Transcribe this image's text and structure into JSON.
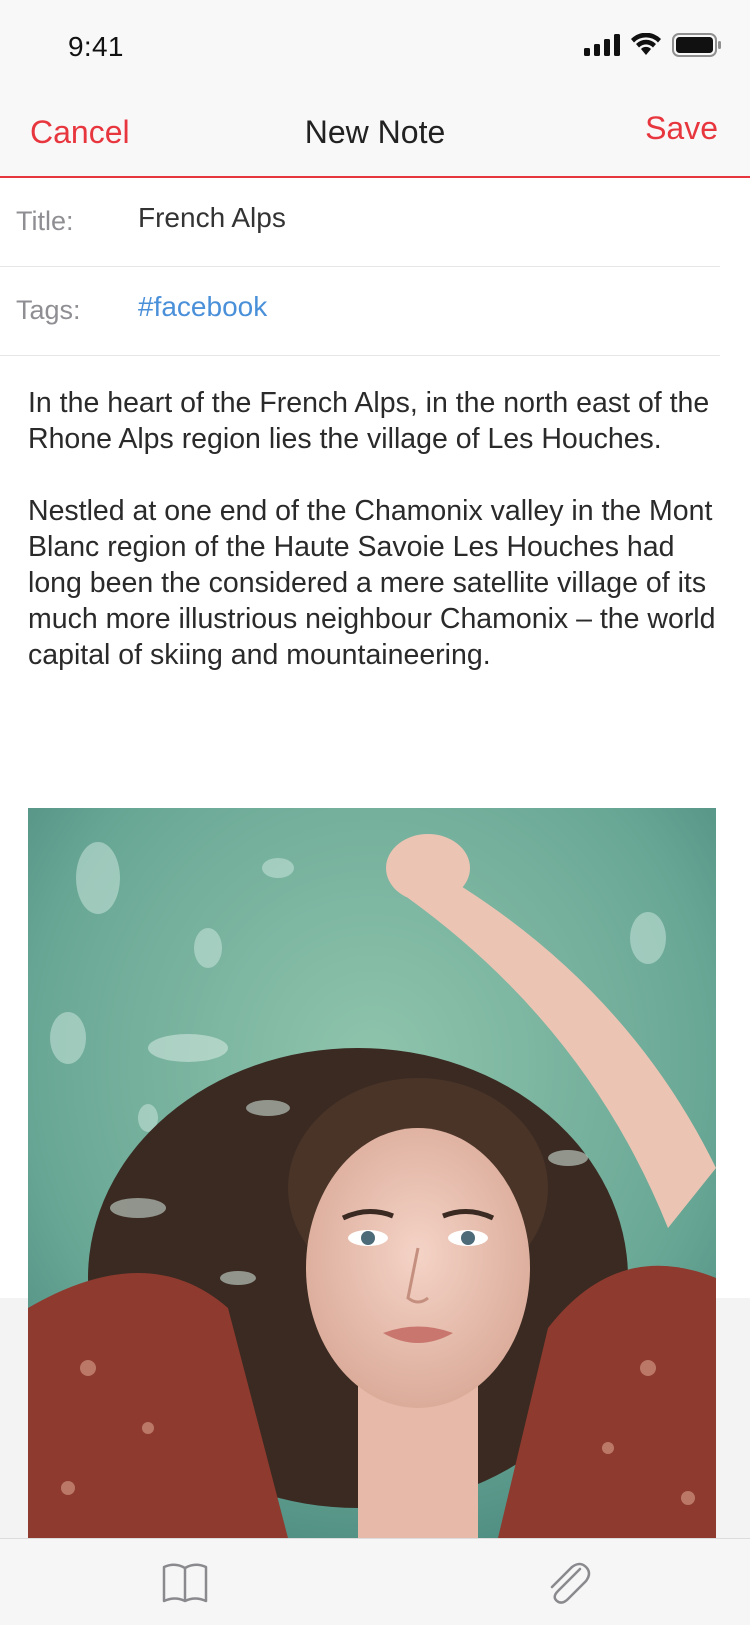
{
  "status_bar": {
    "time": "9:41"
  },
  "nav": {
    "cancel_label": "Cancel",
    "title": "New Note",
    "save_label": "Save"
  },
  "fields": {
    "title_label": "Title:",
    "title_value": "French Alps",
    "tags_label": "Tags:",
    "tags_value": "#facebook"
  },
  "body": {
    "paragraphs": [
      "In the heart of the French Alps, in the north east of the Rhone Alps region lies the village of Les Houches.",
      "Nestled at one end of the Chamonix valley in the Mont Blanc region of the Haute Savoie Les Houches had long been the considered a mere satellite village of its much more illustrious neighbour Chamonix – the world capital of skiing and mountaineering."
    ]
  },
  "toolbar": {
    "left_icon": "book-icon",
    "right_icon": "paperclip-icon"
  },
  "colors": {
    "accent": "#e8363f",
    "tag": "#4a90d9"
  }
}
